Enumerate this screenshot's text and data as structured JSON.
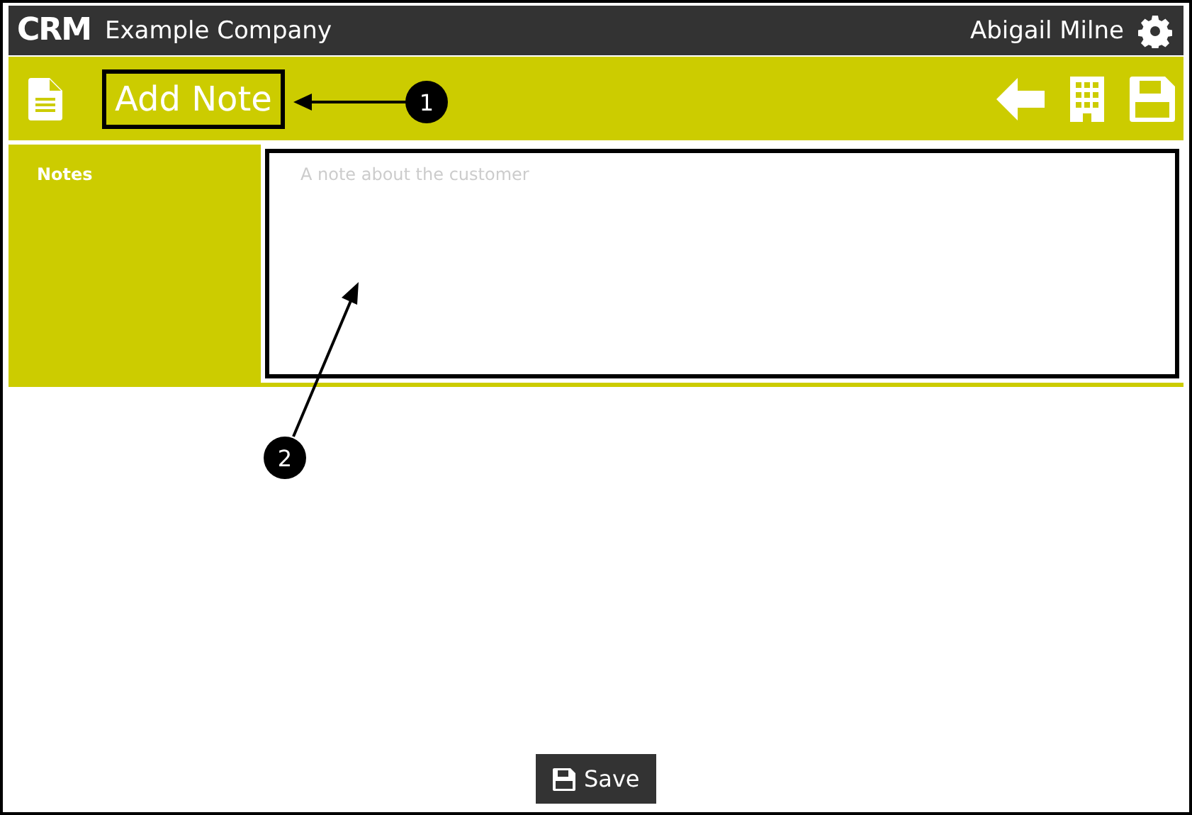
{
  "header": {
    "logo": "CRM",
    "company": "Example Company",
    "user": "Abigail Milne"
  },
  "toolbar": {
    "title": "Add Note"
  },
  "form": {
    "label": "Notes",
    "placeholder": "A note about the customer"
  },
  "save_button": "Save",
  "annotations": [
    "1",
    "2"
  ]
}
